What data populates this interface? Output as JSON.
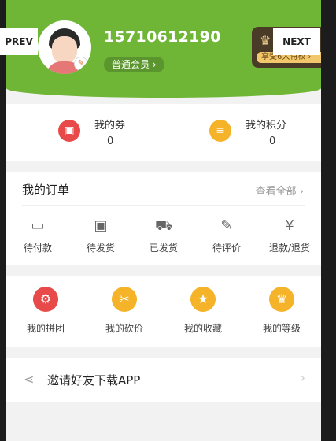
{
  "nav": {
    "prev": "PREV",
    "next": "NEXT"
  },
  "profile": {
    "phone": "15710612190",
    "member_level": "普通会员 ›"
  },
  "vip": {
    "crown": "♛",
    "tagline": "享受6大特权 ›"
  },
  "stats": [
    {
      "label": "我的券",
      "value": "0",
      "icon": "🎫",
      "color": "#e84a4a"
    },
    {
      "label": "我的积分",
      "value": "0",
      "icon": "●",
      "color": "#f5b32a"
    }
  ],
  "orders": {
    "title": "我的订单",
    "view_all": "查看全部 ›",
    "items": [
      {
        "label": "待付款",
        "icon": "wallet-icon",
        "glyph": "▭"
      },
      {
        "label": "待发货",
        "icon": "box-icon",
        "glyph": "▣"
      },
      {
        "label": "已发货",
        "icon": "truck-icon",
        "glyph": "⛟"
      },
      {
        "label": "待评价",
        "icon": "edit-icon",
        "glyph": "✎"
      },
      {
        "label": "退款/退货",
        "icon": "refund-icon",
        "glyph": "¥"
      }
    ]
  },
  "tools": [
    {
      "label": "我的拼团",
      "icon": "group-buy-icon",
      "glyph": "⚙",
      "color": "#e84a4a"
    },
    {
      "label": "我的砍价",
      "icon": "bargain-icon",
      "glyph": "✂",
      "color": "#f5b32a"
    },
    {
      "label": "我的收藏",
      "icon": "favorite-icon",
      "glyph": "★",
      "color": "#f5b32a"
    },
    {
      "label": "我的等级",
      "icon": "level-icon",
      "glyph": "♛",
      "color": "#f5b32a"
    }
  ],
  "invite": {
    "label": "邀请好友下载APP",
    "arrow": "›"
  },
  "colors": {
    "header_green": "#6fb637"
  }
}
